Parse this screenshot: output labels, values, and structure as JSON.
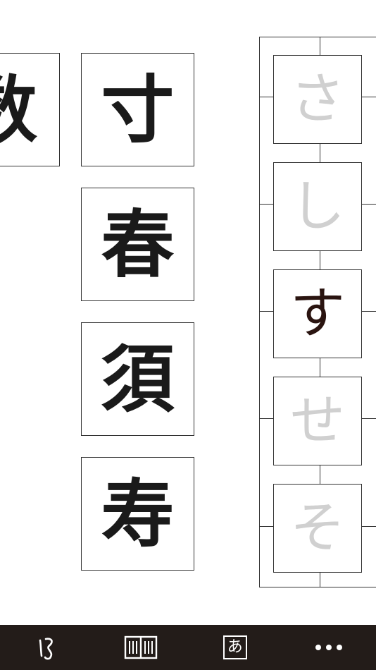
{
  "left_column": {
    "partial_card": {
      "char": "数"
    },
    "cards": [
      {
        "char": "寸"
      },
      {
        "char": "春"
      },
      {
        "char": "須"
      },
      {
        "char": "寿"
      }
    ]
  },
  "kana_column": {
    "items": [
      {
        "char": "さ",
        "state": "inactive"
      },
      {
        "char": "し",
        "state": "inactive"
      },
      {
        "char": "す",
        "state": "active"
      },
      {
        "char": "せ",
        "state": "inactive"
      },
      {
        "char": "そ",
        "state": "inactive"
      }
    ],
    "colors": {
      "active": "#2a1410",
      "inactive": "#d0d0d0"
    }
  },
  "toolbar": {
    "background": "#231c19",
    "items": [
      {
        "icon": "brush-stroke-icon"
      },
      {
        "icon": "book-icon"
      },
      {
        "icon": "hiragana-a-icon",
        "label": "あ",
        "selected": true
      },
      {
        "icon": "more-dots-icon"
      }
    ]
  }
}
